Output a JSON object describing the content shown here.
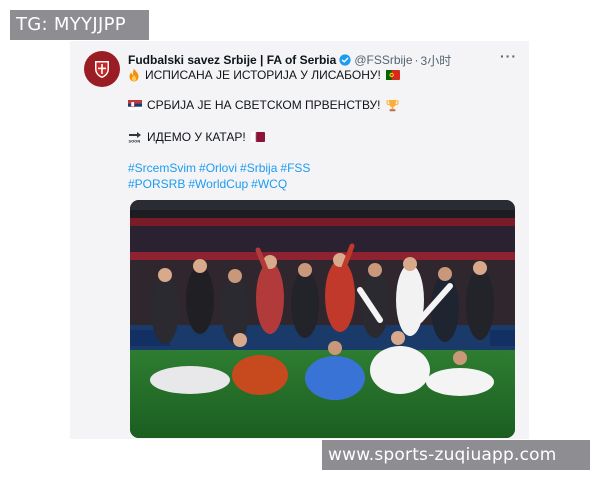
{
  "watermark_top": "TG: MYYJJPP",
  "watermark_bottom": "www.sports-zuqiuapp.com",
  "tweet": {
    "account_name": "Fudbalski savez Srbije | FA of Serbia",
    "handle": "@FSSrbije",
    "separator": "·",
    "time": "3小时",
    "more": "···",
    "lines": [
      {
        "icon": "fire-icon",
        "text": "ИСПИСАНА ЈЕ ИСТОРИЈА У ЛИСАБОНУ!",
        "after_icon": "portugal-flag-icon"
      },
      {
        "icon": "serbia-flag-icon",
        "text": "СРБИЈА ЈЕ НА СВЕТСКОМ ПРВЕНСТВУ!",
        "after_icon": "trophy-icon"
      },
      {
        "icon": "soon-arrow-icon",
        "text": "ИДЕМО У КАТАР!",
        "after_icon": "qatar-flag-icon"
      }
    ],
    "hashtags_row1": [
      "#SrcemSvim",
      "#Orlovi",
      "#Srbija",
      "#FSS"
    ],
    "hashtags_row2": [
      "#PORSRB",
      "#WorldCup",
      "#WCQ"
    ],
    "photo_subject": "Serbian national team celebrating on the pitch"
  },
  "colors": {
    "hashtag": "#1d9bf0",
    "verified": "#1d9bf0",
    "avatar_bg": "#9a1d24",
    "watermark_bg": "#8e8e92"
  }
}
